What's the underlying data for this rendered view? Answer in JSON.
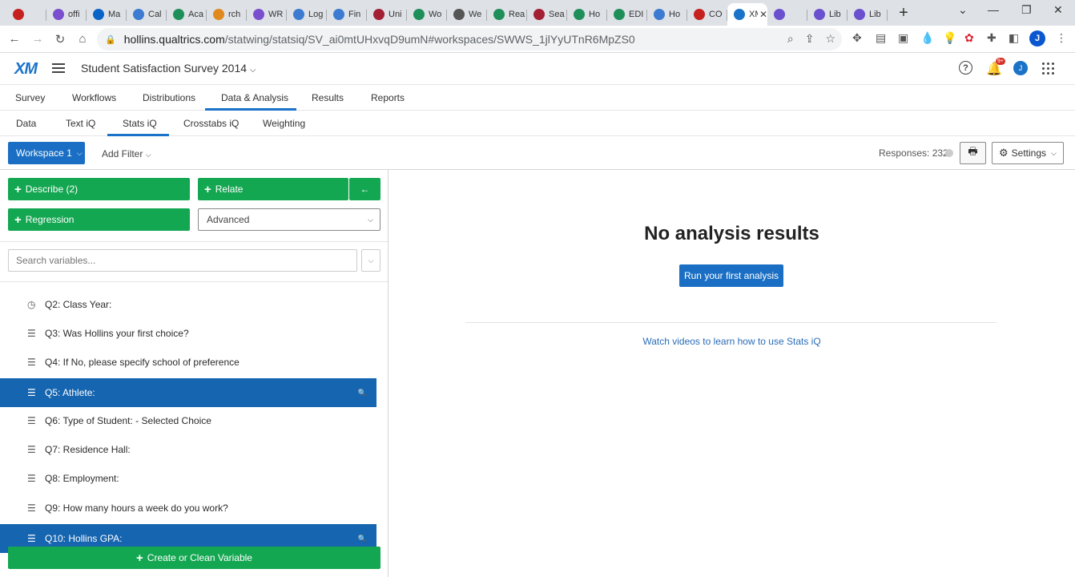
{
  "browser": {
    "tabs": [
      {
        "title": "",
        "color": "#c5221f"
      },
      {
        "title": "offi",
        "color": "#7a4fcf"
      },
      {
        "title": "Ma",
        "color": "#0a64c8"
      },
      {
        "title": "Cal",
        "color": "#3c7bd1"
      },
      {
        "title": "Aca",
        "color": "#1f8f5a"
      },
      {
        "title": "rch",
        "color": "#e08a1e"
      },
      {
        "title": "WR",
        "color": "#7a4fcf"
      },
      {
        "title": "Log",
        "color": "#3c7bd1"
      },
      {
        "title": "Fin",
        "color": "#3c7bd1"
      },
      {
        "title": "Uni",
        "color": "#a31f34"
      },
      {
        "title": "Wo",
        "color": "#1f8f5a"
      },
      {
        "title": "We",
        "color": "#555555"
      },
      {
        "title": "Rea",
        "color": "#1f8f5a"
      },
      {
        "title": "Sea",
        "color": "#a31f34"
      },
      {
        "title": "Ho",
        "color": "#1f8f5a"
      },
      {
        "title": "EDI",
        "color": "#1f8f5a"
      },
      {
        "title": "Ho",
        "color": "#3c7bd1"
      },
      {
        "title": "CO",
        "color": "#c5221f"
      },
      {
        "title": "XM",
        "color": "#1a73c8",
        "active": true
      },
      {
        "title": "",
        "color": "#6a4fcf"
      },
      {
        "title": "Lib",
        "color": "#6a4fcf"
      },
      {
        "title": "Lib",
        "color": "#6a4fcf"
      }
    ],
    "url_host": "hollins.qualtrics.com",
    "url_path": "/statwing/statsiq/SV_ai0mtUHxvqD9umN#workspaces/SWWS_1jlYyUTnR6MpZS0",
    "profile_initial": "J"
  },
  "header": {
    "logo": "XM",
    "project_title": "Student Satisfaction Survey 2014",
    "notification_badge": "9+",
    "user_initial": "J"
  },
  "main_nav": [
    "Survey",
    "Workflows",
    "Distributions",
    "Data & Analysis",
    "Results",
    "Reports"
  ],
  "sub_nav": [
    "Data",
    "Text iQ",
    "Stats iQ",
    "Crosstabs iQ",
    "Weighting"
  ],
  "toolbar": {
    "workspace": "Workspace 1",
    "add_filter": "Add Filter",
    "responses": "Responses: 232",
    "settings": "Settings"
  },
  "left": {
    "describe": "Describe (2)",
    "relate": "Relate",
    "regression": "Regression",
    "advanced": "Advanced",
    "search_placeholder": "Search variables...",
    "variables": [
      {
        "label": "Q2: Class Year:",
        "icon": "clock-icon",
        "selected": false
      },
      {
        "label": "Q3: Was Hollins your first choice?",
        "icon": "list-icon",
        "selected": false
      },
      {
        "label": "Q4: If No, please specify school of preference",
        "icon": "list-icon",
        "selected": false
      },
      {
        "label": "Q5: Athlete:",
        "icon": "list-icon",
        "selected": true
      },
      {
        "label": "Q6: Type of Student: - Selected Choice",
        "icon": "list-icon",
        "selected": false
      },
      {
        "label": "Q7: Residence Hall:",
        "icon": "list-icon",
        "selected": false
      },
      {
        "label": "Q8: Employment:",
        "icon": "list-icon",
        "selected": false
      },
      {
        "label": "Q9: How many hours a week do you work?",
        "icon": "list-icon",
        "selected": false
      },
      {
        "label": "Q10: Hollins GPA:",
        "icon": "list-icon",
        "selected": true
      }
    ],
    "create_variable": "Create or Clean Variable"
  },
  "right": {
    "heading": "No analysis results",
    "run_button": "Run your first analysis",
    "watch_link": "Watch videos to learn how to use Stats iQ"
  }
}
